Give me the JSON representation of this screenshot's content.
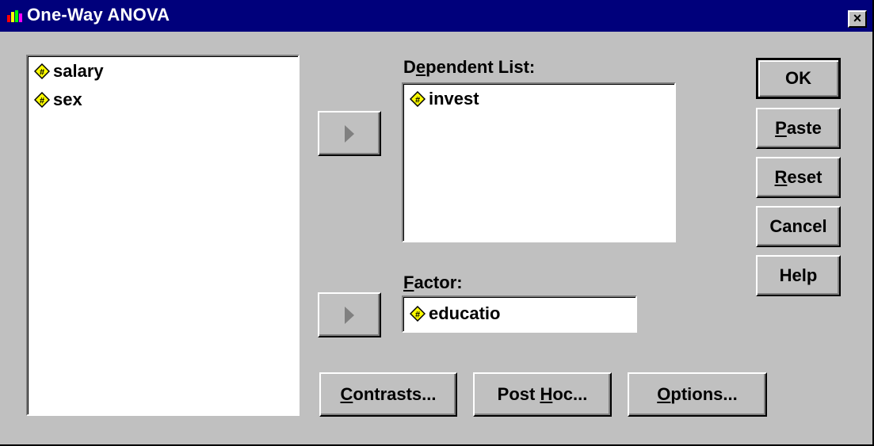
{
  "window": {
    "title": "One-Way ANOVA",
    "close_glyph": "×"
  },
  "source_list": {
    "items": [
      {
        "label": "salary",
        "icon": "numeric-variable-icon"
      },
      {
        "label": "sex",
        "icon": "numeric-variable-icon"
      }
    ]
  },
  "dependent": {
    "label_prefix": "D",
    "label_accel": "e",
    "label_rest": "pendent List:",
    "items": [
      {
        "label": "invest",
        "icon": "numeric-variable-icon"
      }
    ]
  },
  "factor": {
    "label_accel": "F",
    "label_rest": "actor:",
    "value": "educatio"
  },
  "buttons": {
    "ok": "OK",
    "paste": {
      "accel": "P",
      "rest": "aste"
    },
    "reset": {
      "accel": "R",
      "rest": "eset"
    },
    "cancel": "Cancel",
    "help": "Help",
    "contrasts": {
      "accel": "C",
      "rest": "ontrasts..."
    },
    "posthoc": {
      "pre": "Post ",
      "accel": "H",
      "rest": "oc..."
    },
    "options": {
      "accel": "O",
      "rest": "ptions..."
    }
  },
  "colors": {
    "titlebar": "#00007b",
    "face": "#c0c0c0",
    "icon_yellow": "#ffff00"
  }
}
